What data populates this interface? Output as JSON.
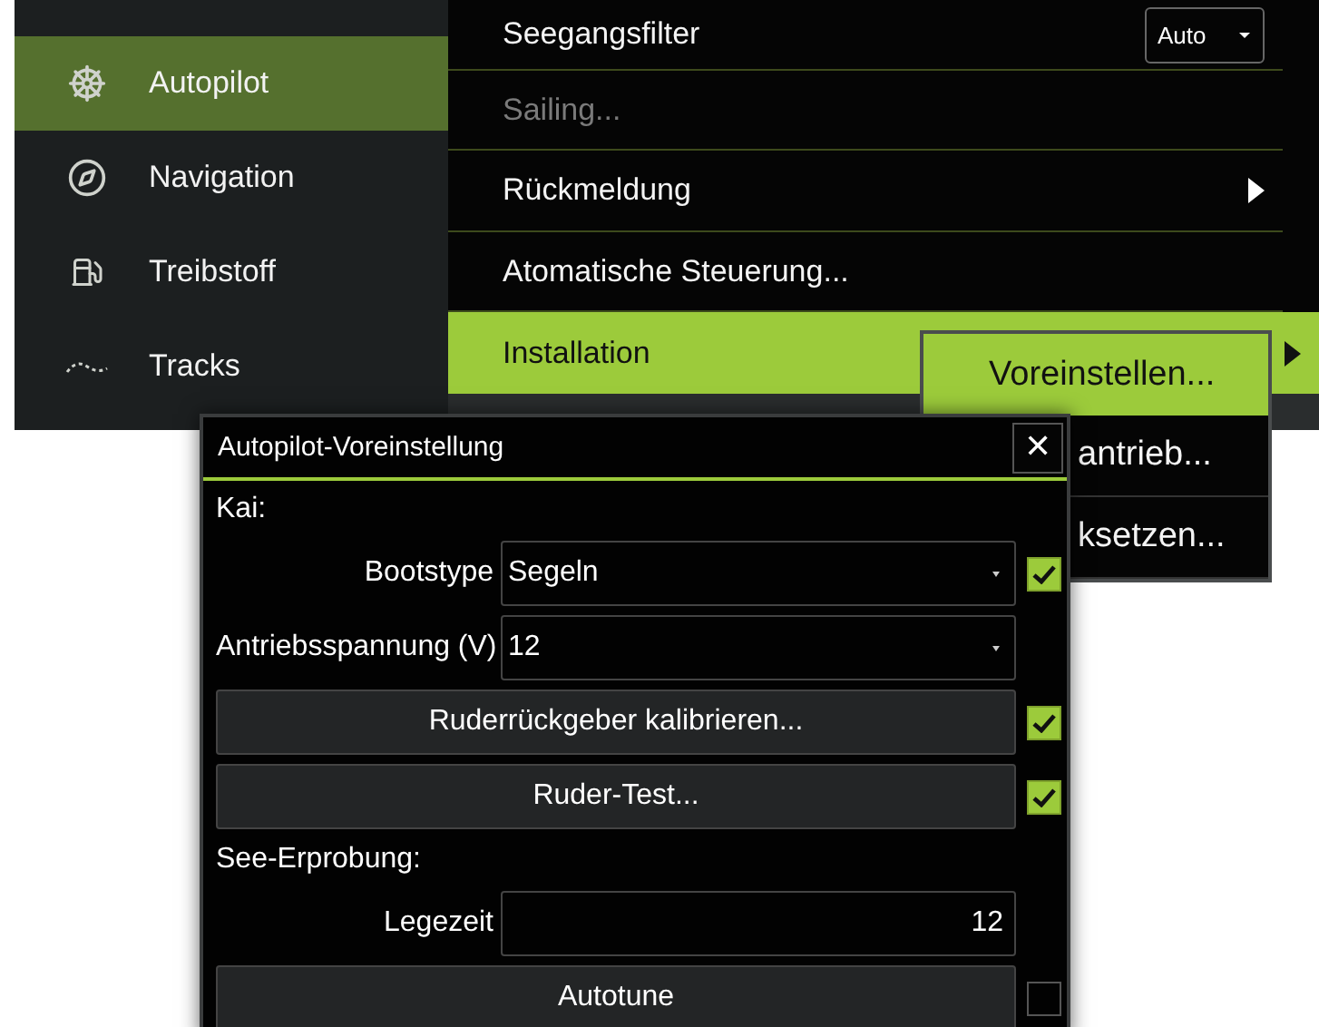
{
  "sidebar": {
    "items": [
      {
        "label": "Autopilot",
        "selected": true
      },
      {
        "label": "Navigation",
        "selected": false
      },
      {
        "label": "Treibstoff",
        "selected": false
      },
      {
        "label": "Tracks",
        "selected": false
      }
    ]
  },
  "menu": {
    "items": [
      {
        "kind": "dropdown",
        "label": "Seegangsfilter",
        "value": "Auto",
        "disabled": false,
        "selected": false
      },
      {
        "kind": "plain",
        "label": "Sailing...",
        "disabled": true,
        "selected": false
      },
      {
        "kind": "submenu",
        "label": "Rückmeldung",
        "disabled": false,
        "selected": false
      },
      {
        "kind": "plain",
        "label": "Atomatische Steuerung...",
        "disabled": false,
        "selected": false
      },
      {
        "kind": "submenu",
        "label": "Installation",
        "disabled": false,
        "selected": true
      }
    ]
  },
  "submenu": {
    "items": [
      {
        "label": "Voreinstellen...",
        "selected": true
      },
      {
        "label": "antrieb...",
        "selected": false
      },
      {
        "label": "ksetzen...",
        "selected": false
      }
    ]
  },
  "dialog": {
    "title": "Autopilot-Voreinstellung",
    "close": "✕",
    "rows": [
      {
        "kind": "section",
        "label": "Kai:"
      },
      {
        "kind": "dropdown",
        "label": "Bootstype",
        "value": "Segeln",
        "checked": true
      },
      {
        "kind": "dropdown",
        "label": "Antriebsspannung (V)",
        "value": "12"
      },
      {
        "kind": "button",
        "label": "Ruderrückgeber kalibrieren...",
        "checked": true
      },
      {
        "kind": "button",
        "label": "Ruder-Test...",
        "checked": true
      },
      {
        "kind": "section",
        "label": "See-Erprobung:"
      },
      {
        "kind": "input",
        "label": "Legezeit",
        "value": "12"
      },
      {
        "kind": "button",
        "label": "Autotune",
        "checked": false
      }
    ]
  }
}
